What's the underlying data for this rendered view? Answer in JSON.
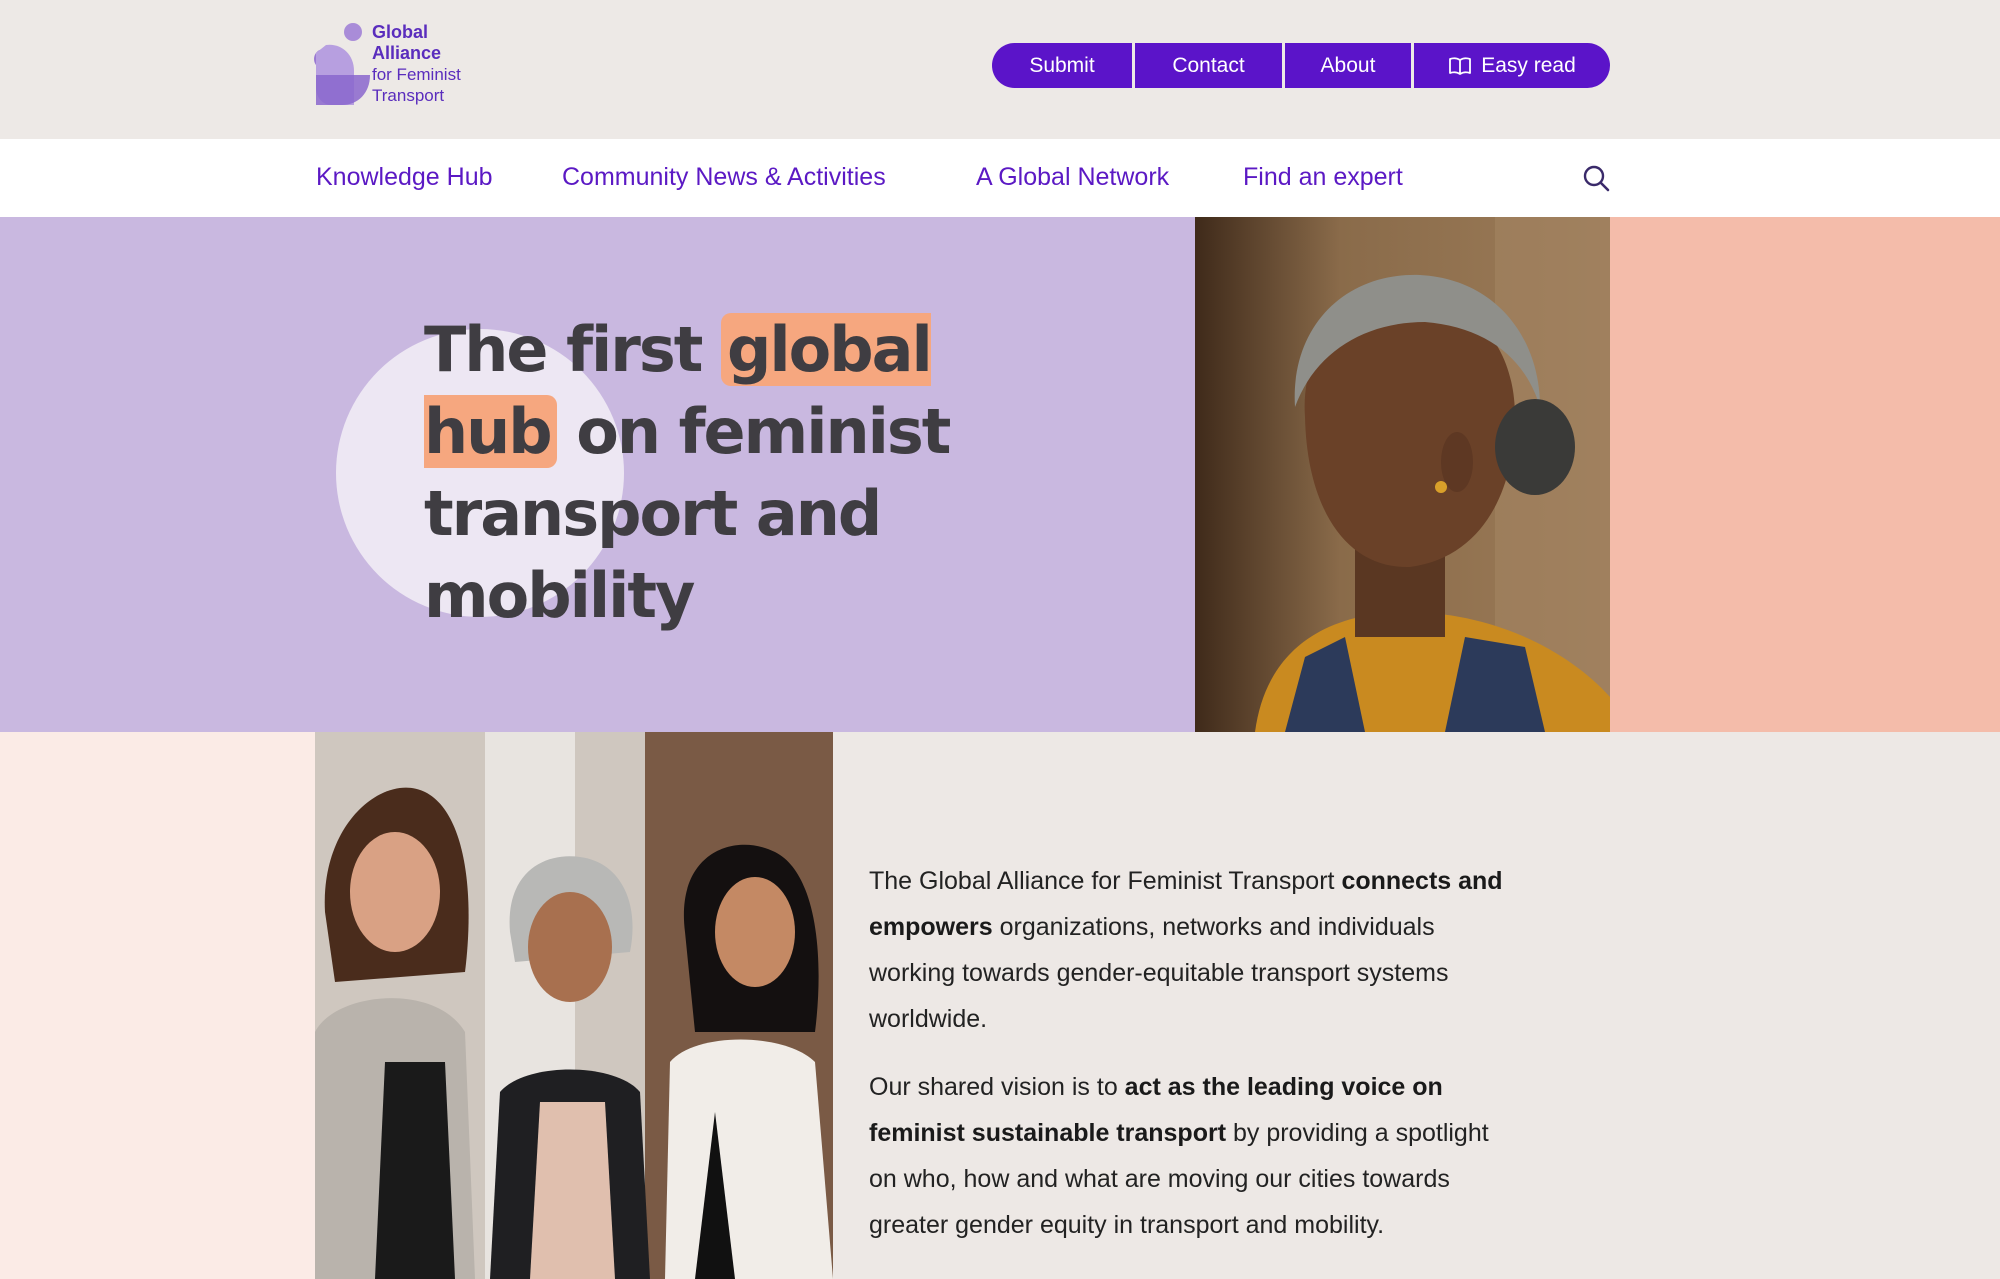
{
  "colors": {
    "brand_purple": "#5b14c9",
    "hero_lavender": "#c9b8e0",
    "hero_peach": "#f4bcaa",
    "highlight": "#f6a77f"
  },
  "logo": {
    "line1": "Global",
    "line2": "Alliance",
    "line3": "for Feminist",
    "line4": "Transport"
  },
  "top_links": {
    "submit": "Submit",
    "contact": "Contact",
    "about": "About",
    "easy_read": "Easy read",
    "easy_read_icon": "open-book-icon"
  },
  "nav": {
    "items": [
      {
        "label": "Knowledge Hub"
      },
      {
        "label": "Community News & Activities"
      },
      {
        "label": "A Global Network"
      },
      {
        "label": "Find an expert"
      }
    ],
    "search_icon": "search-icon"
  },
  "hero": {
    "title_part1": "The first ",
    "title_highlight": "global hub",
    "title_part2": "on feminist transport and mobility"
  },
  "intro": {
    "p1_a": "The Global Alliance for Feminist Transport ",
    "p1_b": "connects and empowers",
    "p1_c": " organizations, networks and individuals working towards gender-equitable transport systems worldwide.",
    "p2_a": "Our shared vision is to ",
    "p2_b": "act as the leading voice on feminist sustainable transport",
    "p2_c": " by providing a spotlight on who, how and what are moving our cities towards greater gender equity in transport and mobility."
  }
}
